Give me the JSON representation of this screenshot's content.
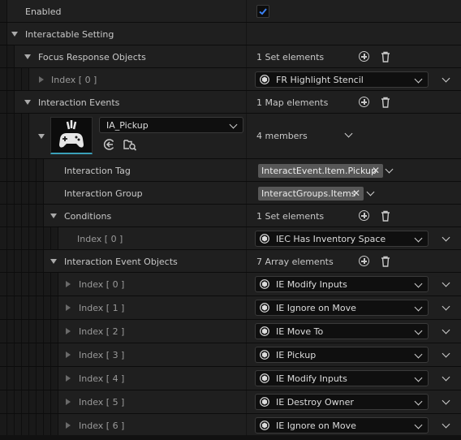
{
  "enabled": {
    "label": "Enabled",
    "checked": true
  },
  "interactable_setting": {
    "label": "Interactable Setting"
  },
  "focus_response": {
    "label": "Focus Response Objects",
    "count": "1 Set elements",
    "index_label": "Index [ 0 ]",
    "value": "FR Highlight Stencil"
  },
  "interaction_events": {
    "label": "Interaction Events",
    "count": "1 Map elements",
    "key_action": "IA_Pickup",
    "members": "4 members",
    "interaction_tag": {
      "label": "Interaction Tag",
      "value": "InteractEvent.Item.Pickup"
    },
    "interaction_group": {
      "label": "Interaction Group",
      "value": "InteractGroups.Items"
    },
    "conditions": {
      "label": "Conditions",
      "count": "1 Set elements",
      "index_label": "Index [ 0 ]",
      "value": "IEC Has Inventory Space"
    },
    "event_objects": {
      "label": "Interaction Event Objects",
      "count": "7 Array elements",
      "items": [
        {
          "index": "Index [ 0 ]",
          "value": "IE Modify Inputs"
        },
        {
          "index": "Index [ 1 ]",
          "value": "IE Ignore on Move"
        },
        {
          "index": "Index [ 2 ]",
          "value": "IE Move To"
        },
        {
          "index": "Index [ 3 ]",
          "value": "IE Pickup"
        },
        {
          "index": "Index [ 4 ]",
          "value": "IE Modify Inputs"
        },
        {
          "index": "Index [ 5 ]",
          "value": "IE Destroy Owner"
        },
        {
          "index": "Index [ 6 ]",
          "value": "IE Ignore on Move"
        }
      ]
    }
  },
  "icons": {
    "add": "plus-circle-icon",
    "delete": "trash-icon",
    "asset": "unreal-asset-icon",
    "use_selected": "arrow-left-circle-icon",
    "browse": "folder-search-icon",
    "input_action": "gamepad-icon"
  },
  "colors": {
    "check_accent": "#3b82f6",
    "tag_bg": "#575757",
    "row_bg": "#1f1f1f"
  }
}
